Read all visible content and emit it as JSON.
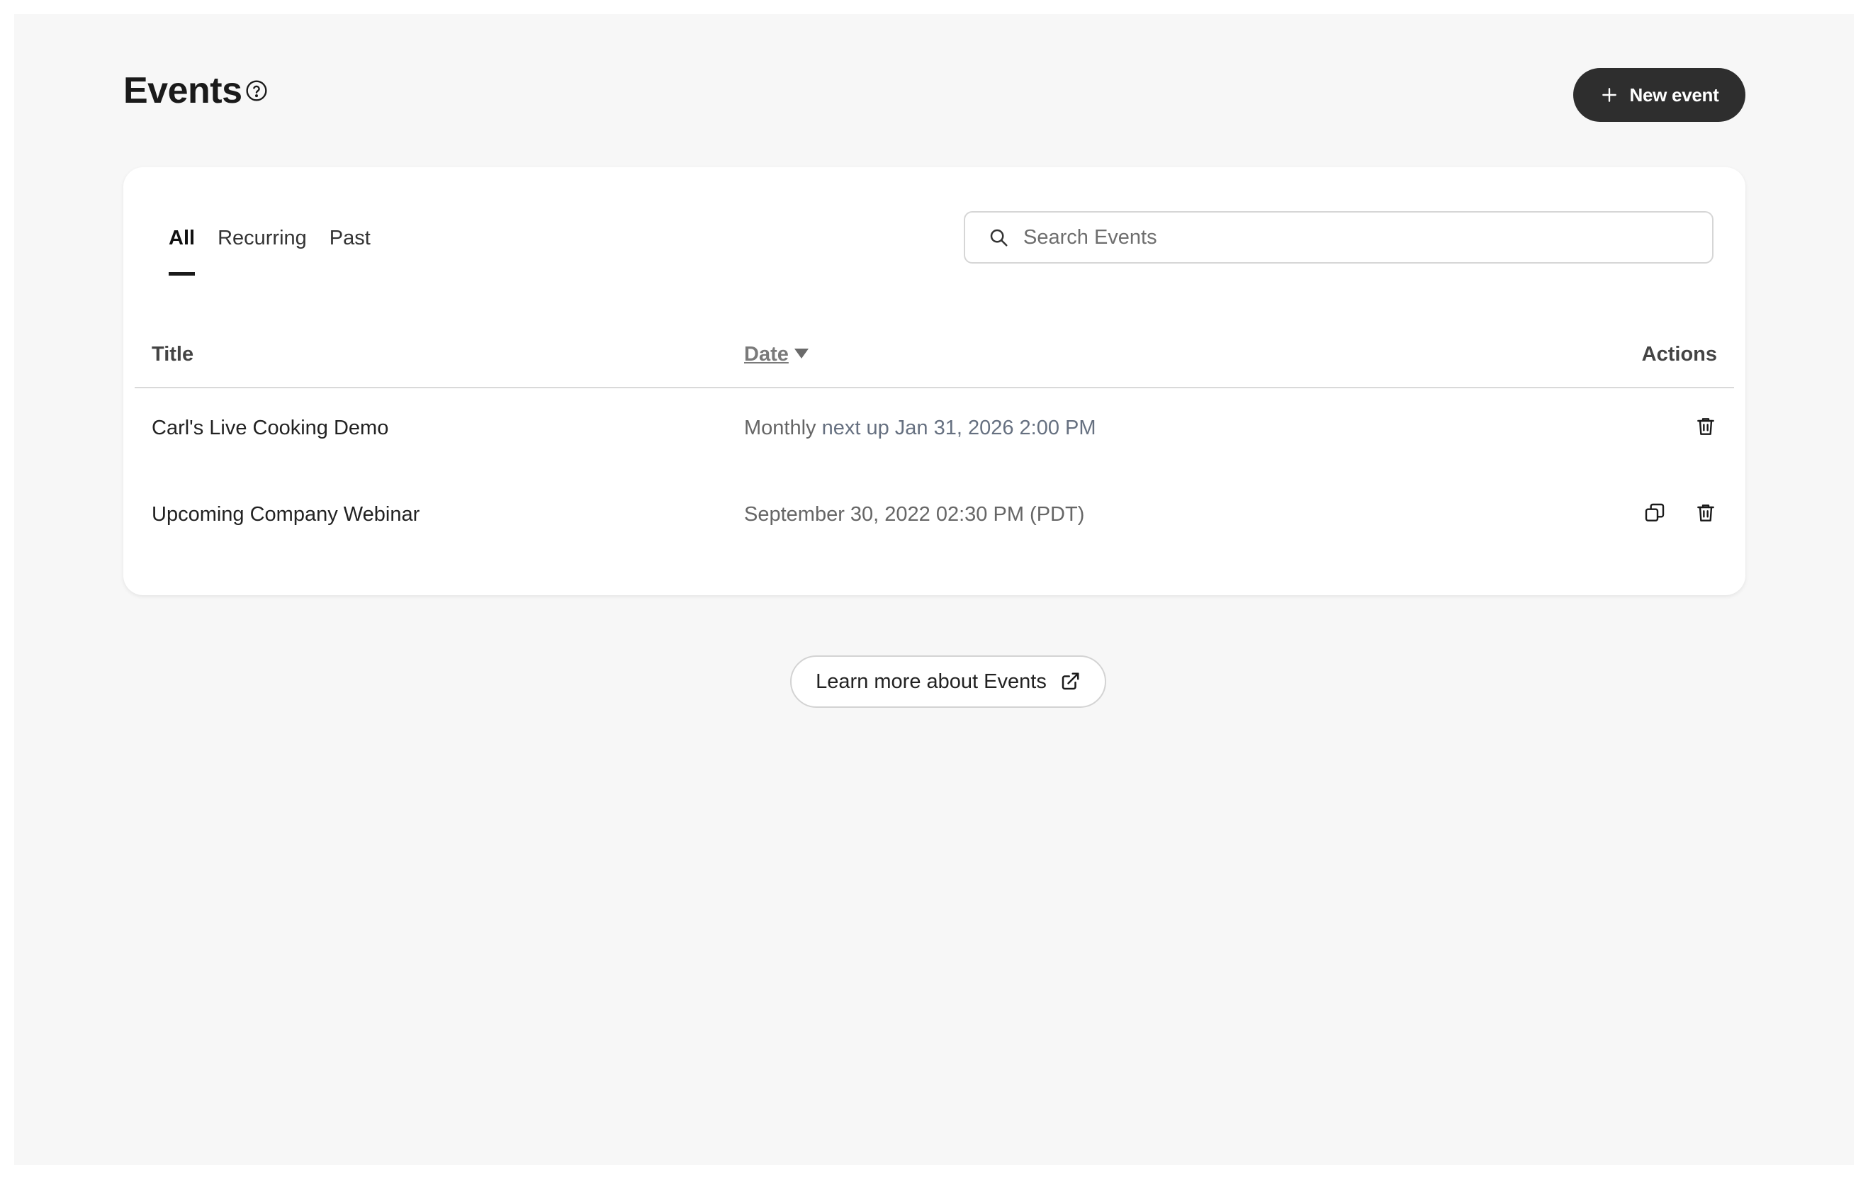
{
  "header": {
    "title": "Events",
    "help_icon": "question-circle-icon",
    "new_event_label": "New event",
    "new_event_icon": "plus-icon"
  },
  "tabs": [
    {
      "label": "All",
      "active": true
    },
    {
      "label": "Recurring",
      "active": false
    },
    {
      "label": "Past",
      "active": false
    }
  ],
  "search": {
    "placeholder": "Search Events",
    "value": "",
    "icon": "search-icon"
  },
  "table": {
    "columns": {
      "title": "Title",
      "date": "Date",
      "actions": "Actions"
    },
    "sort": {
      "column": "Date",
      "direction": "descending"
    },
    "rows": [
      {
        "title": "Carl's Live Cooking Demo",
        "date_prefix": "Monthly",
        "date_detail": "next up Jan 31, 2026 2:00 PM",
        "actions": [
          "trash-icon"
        ]
      },
      {
        "title": "Upcoming Company Webinar",
        "date_prefix": "September 30, 2022 02:30 PM (PDT)",
        "date_detail": "",
        "actions": [
          "duplicate-icon",
          "trash-icon"
        ]
      }
    ]
  },
  "footer": {
    "learn_more_label": "Learn more about Events",
    "learn_more_icon": "external-link-icon"
  },
  "colors": {
    "background": "#f7f7f7",
    "card": "#ffffff",
    "primary_button": "#2e2e2e",
    "text": "#1f1f1f"
  }
}
